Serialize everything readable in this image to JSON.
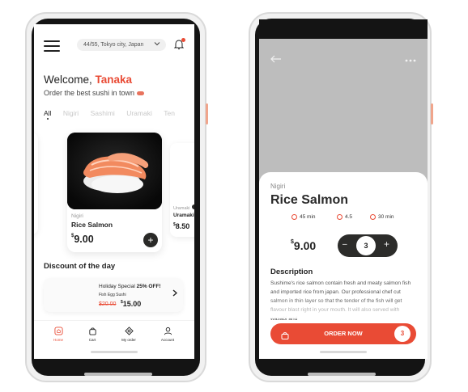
{
  "left_screen": {
    "location": "44/55, Tokyo city, Japan",
    "welcome_prefix": "Welcome, ",
    "welcome_name": "Tanaka",
    "tagline": "Order the best sushi in town",
    "tabs": [
      "All",
      "Nigiri",
      "Sashimi",
      "Uramaki",
      "Ten"
    ],
    "featured": {
      "category": "Nigiri",
      "name": "Rice Salmon",
      "currency": "$",
      "price": "9.00"
    },
    "right_peek": {
      "category": "Uramaki",
      "name": "Uramaki",
      "currency": "$",
      "price": "8.50"
    },
    "discount_title": "Discount of the day",
    "promo": {
      "title_prefix": "Holiday Special ",
      "title_pct": "25% OFF!",
      "item": "Fish Egg Sushi",
      "old_price": "$20.00",
      "new_currency": "$",
      "new_price": "15.00"
    },
    "nav": [
      "Home",
      "Cart",
      "My order",
      "Account"
    ],
    "colors": {
      "accent": "#e94b35",
      "dark": "#2a2a28"
    }
  },
  "right_screen": {
    "category": "Nigiri",
    "name": "Rice Salmon",
    "meta": {
      "time": "45 min",
      "rating": "4.5",
      "calories": "30 min"
    },
    "currency": "$",
    "price": "9.00",
    "qty": "3",
    "minus": "–",
    "plus": "+",
    "description_title": "Description",
    "description": "Sushime's rice salmon contain fresh and meaty salmon fish and imported rice from japan. Our professional chef cut salmon in thin layer so that the tender of the fish will get flavour blast right in your mouth. It will also served with wasabi and",
    "order_label": "ORDER NOW",
    "order_count": "3"
  }
}
